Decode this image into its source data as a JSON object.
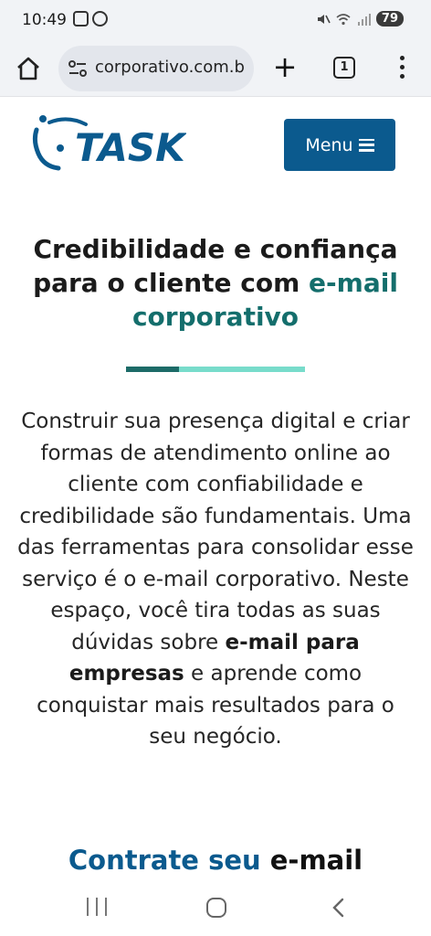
{
  "status_bar": {
    "time": "10:49",
    "battery": "79",
    "left_icons": [
      "screenshot-icon",
      "whatsapp-icon"
    ],
    "right_icons": [
      "mute-icon",
      "wifi-icon",
      "signal-icon",
      "battery-icon"
    ]
  },
  "browser": {
    "url": "corporativo.com.br",
    "tab_count": "1",
    "icons": [
      "home-icon",
      "site-settings-icon",
      "new-tab-plus-icon",
      "tab-switcher-icon",
      "more-menu-icon"
    ]
  },
  "site": {
    "logo_text": "TASK",
    "menu_label": "Menu",
    "brand_color": "#0b5a8e",
    "accent_color": "#146e6c"
  },
  "heading": {
    "part1": "Credibilidade e confiança para o cliente com ",
    "accent": "e-mail corporativo"
  },
  "paragraph": {
    "part1": "Construir sua presença digital e criar formas de atendimento online ao cliente com confiabilidade e credibilidade são fundamentais. Uma das ferramentas para consolidar esse serviço é o e-mail corporativo. Neste espaço, você tira todas as suas dúvidas sobre ",
    "bold": "e-mail para empresas",
    "part2": " e aprende como conquistar mais resultados para o seu negócio."
  },
  "cta": {
    "part1": "Contrate seu ",
    "part2": "e-mail"
  },
  "nav": {
    "icons": [
      "recents-icon",
      "home-circle-icon",
      "back-icon"
    ]
  }
}
